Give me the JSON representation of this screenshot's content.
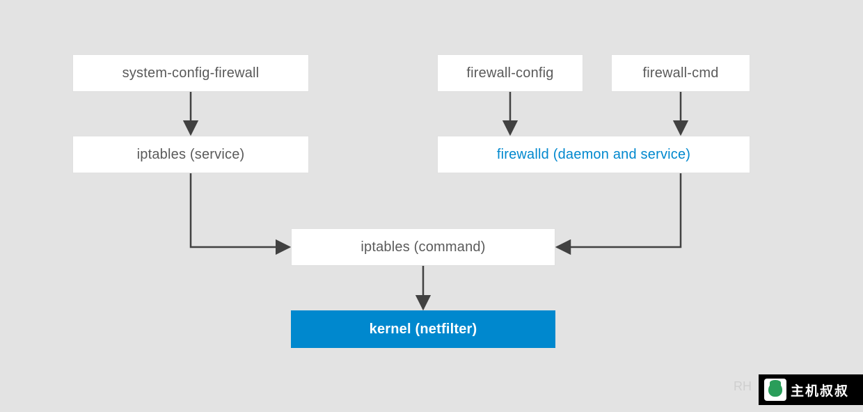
{
  "diagram": {
    "type": "firewall-stack-architecture",
    "nodes": {
      "system_config_firewall": {
        "label": "system-config-firewall",
        "style": "plain"
      },
      "firewall_config": {
        "label": "firewall-config",
        "style": "plain"
      },
      "firewall_cmd": {
        "label": "firewall-cmd",
        "style": "plain"
      },
      "iptables_service": {
        "label": "iptables (service)",
        "style": "plain"
      },
      "firewalld_daemon": {
        "label": "firewalld (daemon and service)",
        "style": "highlight"
      },
      "iptables_command": {
        "label": "iptables (command)",
        "style": "plain"
      },
      "kernel_netfilter": {
        "label": "kernel (netfilter)",
        "style": "kernel"
      }
    },
    "edges": [
      {
        "from": "system_config_firewall",
        "to": "iptables_service"
      },
      {
        "from": "firewall_config",
        "to": "firewalld_daemon"
      },
      {
        "from": "firewall_cmd",
        "to": "firewalld_daemon"
      },
      {
        "from": "iptables_service",
        "to": "iptables_command"
      },
      {
        "from": "firewalld_daemon",
        "to": "iptables_command"
      },
      {
        "from": "iptables_command",
        "to": "kernel_netfilter"
      }
    ]
  },
  "watermark": {
    "rh_text": "RH",
    "logo_text": "主机叔叔"
  },
  "colors": {
    "bg": "#e3e3e3",
    "box_bg": "#ffffff",
    "text": "#5a5a5a",
    "accent": "#0088ce",
    "arrow": "#414141"
  }
}
